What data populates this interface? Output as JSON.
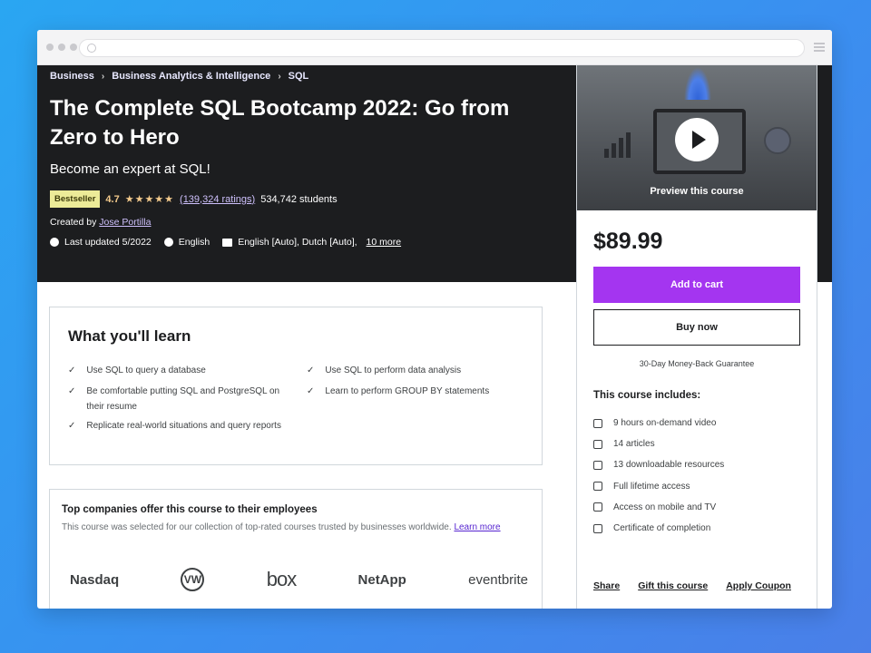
{
  "breadcrumb": [
    "Business",
    "Business Analytics & Intelligence",
    "SQL"
  ],
  "course": {
    "title": "The Complete SQL Bootcamp 2022: Go from Zero to Hero",
    "subtitle": "Become an expert at SQL!",
    "badge": "Bestseller",
    "rating": "4.7",
    "stars": "★★★★★",
    "ratings_count": "(139,324 ratings)",
    "students": "534,742 students",
    "created_by_label": "Created by",
    "author": "Jose Portilla",
    "last_updated": "Last updated 5/2022",
    "language": "English",
    "captions": "English [Auto], Dutch [Auto],",
    "captions_more": "10 more"
  },
  "sidebar": {
    "preview_label": "Preview this course",
    "price": "$89.99",
    "add_to_cart": "Add to cart",
    "buy_now": "Buy now",
    "guarantee": "30-Day Money-Back Guarantee",
    "includes_title": "This course includes:",
    "includes": [
      {
        "icon": "video-icon",
        "text": "9 hours on-demand video"
      },
      {
        "icon": "article-icon",
        "text": "14 articles"
      },
      {
        "icon": "download-icon",
        "text": "13 downloadable resources"
      },
      {
        "icon": "infinity-icon",
        "text": "Full lifetime access"
      },
      {
        "icon": "mobile-icon",
        "text": "Access on mobile and TV"
      },
      {
        "icon": "trophy-icon",
        "text": "Certificate of completion"
      }
    ],
    "share": "Share",
    "gift": "Gift this course",
    "coupon": "Apply Coupon"
  },
  "learn": {
    "title": "What you'll learn",
    "items": [
      "Use SQL to query a database",
      "Use SQL to perform data analysis",
      "Be comfortable putting SQL and PostgreSQL on their resume",
      "Learn to perform GROUP BY statements",
      "Replicate real-world situations and query reports"
    ]
  },
  "companies": {
    "title": "Top companies offer this course to their employees",
    "description": "This course was selected for our collection of top-rated courses trusted by businesses worldwide.",
    "learn_more": "Learn more",
    "logos": [
      "Nasdaq",
      "VW",
      "box",
      "NetApp",
      "eventbrite"
    ]
  },
  "colors": {
    "hero_bg": "#1c1d1f",
    "accent_purple": "#a435f0",
    "badge_bg": "#eceb98",
    "star": "#f3ca8c",
    "page_bg": "#2aa6f2"
  }
}
